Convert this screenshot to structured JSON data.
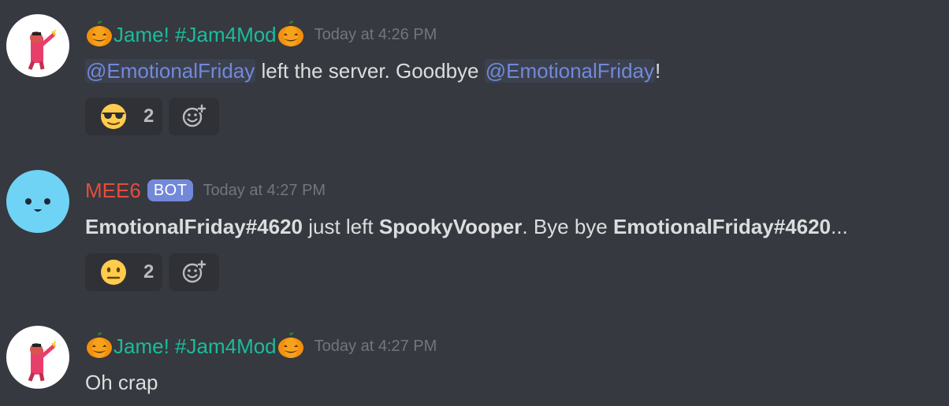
{
  "messages": [
    {
      "author": "Jame! #Jam4Mod",
      "timestamp": "Today at 4:26 PM",
      "content": {
        "mention1": "@EmotionalFriday",
        "text1": " left the server. Goodbye ",
        "mention2": "@EmotionalFriday",
        "text2": "!"
      },
      "reaction": {
        "emoji": "sunglasses-emoji",
        "count": "2"
      }
    },
    {
      "author": "MEE6",
      "badge": "BOT",
      "timestamp": "Today at 4:27 PM",
      "content": {
        "bold1": "EmotionalFriday#4620",
        "text1": " just left ",
        "bold2": "SpookyVooper",
        "text2": ". Bye bye ",
        "bold3": "EmotionalFriday#4620",
        "text3": "..."
      },
      "reaction": {
        "emoji": "neutral-face-emoji",
        "count": "2"
      }
    },
    {
      "author": "Jame! #Jam4Mod",
      "timestamp": "Today at 4:27 PM",
      "content": {
        "text1": "Oh crap"
      }
    }
  ],
  "colors": {
    "background": "#36393f",
    "jame_name": "#1abc9c",
    "mee6_name": "#e74c3c",
    "mention": "#7289da",
    "bot_badge": "#7289da",
    "timestamp": "#72767d"
  }
}
